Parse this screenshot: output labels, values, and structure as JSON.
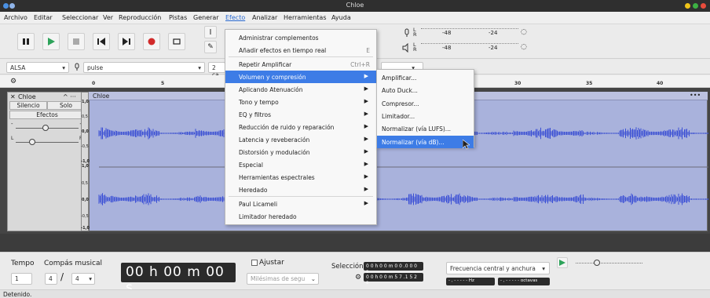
{
  "window": {
    "title": "Chloe"
  },
  "menubar": [
    "Archivo",
    "Editar",
    "Seleccionar",
    "Ver",
    "Reproducción",
    "Pistas",
    "Generar",
    "Efecto",
    "Analizar",
    "Herramientas",
    "Ayuda"
  ],
  "meter": {
    "rec_lr": "L\nR",
    "scale_a": "-48",
    "scale_b": "-24"
  },
  "device": {
    "host": "ALSA",
    "input": "pulse",
    "channels": "2 ca"
  },
  "ruler_ticks": [
    "0",
    "5",
    "30",
    "35",
    "40"
  ],
  "track": {
    "name": "Chloe",
    "mute": "Silencio",
    "solo": "Solo",
    "effects": "Efectos",
    "clip_name": "Chloe",
    "clip_menu": "•••",
    "scale": [
      "1,0",
      "0,5",
      "0,0",
      "-0,5",
      "-1,0",
      "1,0",
      "0,5",
      "0,0",
      "-0,5",
      "-1,0"
    ],
    "pan_l": "L",
    "pan_r": "R",
    "gain_minus": "-",
    "gain_plus": "+"
  },
  "effect_menu": {
    "items": [
      {
        "label": "Administrar complementos",
        "shortcut": "",
        "arrow": false
      },
      {
        "label": "Añadir efectos en tiempo real",
        "shortcut": "E",
        "arrow": false
      },
      {
        "label": "Repetir Amplificar",
        "shortcut": "Ctrl+R",
        "arrow": false
      },
      {
        "label": "Volumen y compresión",
        "shortcut": "",
        "arrow": true,
        "highlight": true
      },
      {
        "label": "Aplicando Atenuación",
        "shortcut": "",
        "arrow": true
      },
      {
        "label": "Tono y tempo",
        "shortcut": "",
        "arrow": true
      },
      {
        "label": "EQ y filtros",
        "shortcut": "",
        "arrow": true
      },
      {
        "label": "Reducción de ruido y reparación",
        "shortcut": "",
        "arrow": true
      },
      {
        "label": "Latencia y reveberación",
        "shortcut": "",
        "arrow": true
      },
      {
        "label": "Distorsión y modulación",
        "shortcut": "",
        "arrow": true
      },
      {
        "label": "Especial",
        "shortcut": "",
        "arrow": true
      },
      {
        "label": "Herramientas espectrales",
        "shortcut": "",
        "arrow": true
      },
      {
        "label": "Heredado",
        "shortcut": "",
        "arrow": true
      },
      {
        "label": "Paul Licameli",
        "shortcut": "",
        "arrow": true
      },
      {
        "label": "Limitador heredado",
        "shortcut": "",
        "arrow": false
      }
    ]
  },
  "submenu": {
    "items": [
      {
        "label": "Amplificar..."
      },
      {
        "label": "Auto Duck..."
      },
      {
        "label": "Compresor..."
      },
      {
        "label": "Limitador..."
      },
      {
        "label": "Normalizar (vía LUFS)..."
      },
      {
        "label": "Normalizar (vía dB)...",
        "highlight": true
      }
    ]
  },
  "bottom": {
    "tempo_label": "Tempo",
    "signature_label": "Compás musical",
    "tempo_value": "1",
    "sig_num": "4",
    "sig_den": "4",
    "slash": "/",
    "time_display": "00 h 00 m 00 s",
    "snap_label": "Ajustar",
    "snap_unit": "Milésimas de segu",
    "selection_label": "Selección",
    "sel_start": "0 0 h 0 0 m 0 0 .0 0 0 s",
    "sel_end": "0 0 h 0 0 m 5 7 .1 5 2 s",
    "spectral_mode": "Frecuencia central y anchura",
    "hz_box": "- , - - - - - Hz",
    "oct_box": "- , - - - - - octavas"
  },
  "status": "Detenido.",
  "colors": {
    "accent": "#3d7ce6",
    "wave": "#3a4fd6",
    "clip": "#a9b2dc",
    "record": "#d12a2a",
    "play": "#2da35a"
  }
}
